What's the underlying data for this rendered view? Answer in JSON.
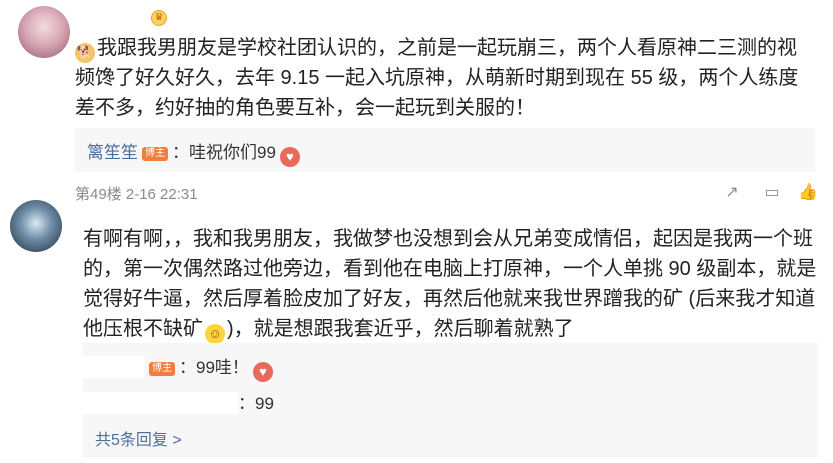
{
  "comment1": {
    "text": "我跟我男朋友是学校社团认识的，之前是一起玩崩三，两个人看原神二三测的视频馋了好久好久，去年 9.15 一起入坑原神，从萌新时期到现在 55 级，两个人练度差不多，约好抽的角色要互补，会一起玩到关服的！",
    "reply": {
      "author": "篱笙笙",
      "tag": "博主",
      "text": "：哇祝你们99"
    }
  },
  "comment2": {
    "floor": "第49楼",
    "time": "2-16 22:31",
    "text_part1": "有啊有啊，，我和我男朋友，我做梦也没想到会从兄弟变成情侣，起因是我两一个班的，第一次偶然路过他旁边，看到他在电脑上打原神，一个人单挑 90 级副本，就是觉得好牛逼，然后厚着脸皮加了好友，再然后他就来我世界蹭我的矿 (后来我才知道他压根不缺矿",
    "text_part2": ")，就是想跟我套近乎，然后聊着就熟了",
    "replies": [
      {
        "tag": "博主",
        "text": "：99哇！"
      },
      {
        "text": "：99"
      }
    ],
    "more": "共5条回复 >"
  },
  "icons": {
    "share": "share-icon",
    "comment": "comment-icon",
    "like": "like-icon",
    "vip": "vip-badge-icon"
  },
  "colors": {
    "link": "#4d6f9e",
    "host_tag": "#f47c3c",
    "reply_bg": "#f7f7f7"
  }
}
